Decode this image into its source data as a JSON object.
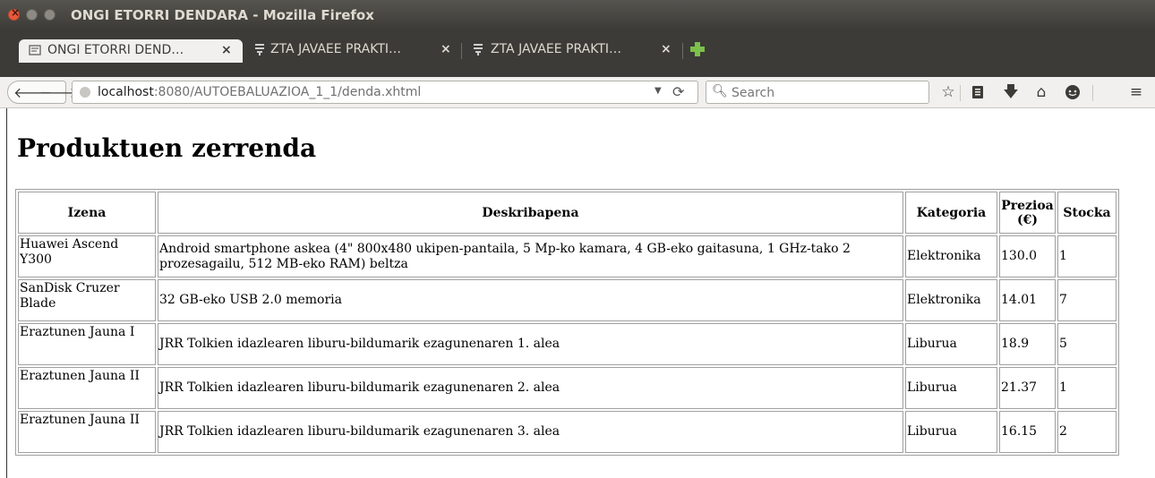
{
  "window": {
    "title": "ONGI ETORRI DENDARA - Mozilla Firefox"
  },
  "tabs": [
    {
      "label": "ONGI ETORRI DEND…",
      "active": true
    },
    {
      "label": "ZTA JAVAEE PRAKTI…",
      "active": false
    },
    {
      "label": "ZTA JAVAEE PRAKTI…",
      "active": false
    }
  ],
  "navbar": {
    "url_host": "localhost",
    "url_rest": ":8080/AUTOEBALUAZIOA_1_1/denda.xhtml",
    "search_placeholder": "Search",
    "icons": [
      "back-icon",
      "forward-icon",
      "reload-icon",
      "bookmark-star-icon",
      "reading-list-icon",
      "download-icon",
      "home-icon",
      "hello-icon",
      "menu-icon"
    ]
  },
  "page": {
    "heading": "Produktuen zerrenda",
    "columns": [
      "Izena",
      "Deskribapena",
      "Kategoria",
      "Prezioa (€)",
      "Stocka"
    ],
    "rows": [
      {
        "izena": "Huawei Ascend Y300",
        "deskribapena": "Android smartphone askea (4\" 800x480 ukipen-pantaila, 5 Mp-ko kamara, 4 GB-eko gaitasuna, 1 GHz-tako 2 prozesagailu, 512 MB-eko RAM) beltza",
        "kategoria": "Elektronika",
        "prezioa": "130.0",
        "stocka": "1"
      },
      {
        "izena": "SanDisk Cruzer Blade",
        "deskribapena": "32 GB-eko USB 2.0 memoria",
        "kategoria": "Elektronika",
        "prezioa": "14.01",
        "stocka": "7"
      },
      {
        "izena": "Eraztunen Jauna I",
        "deskribapena": "JRR Tolkien idazlearen liburu-bildumarik ezagunenaren 1. alea",
        "kategoria": "Liburua",
        "prezioa": "18.9",
        "stocka": "5"
      },
      {
        "izena": "Eraztunen Jauna II",
        "deskribapena": "JRR Tolkien idazlearen liburu-bildumarik ezagunenaren 2. alea",
        "kategoria": "Liburua",
        "prezioa": "21.37",
        "stocka": "1"
      },
      {
        "izena": "Eraztunen Jauna II",
        "deskribapena": "JRR Tolkien idazlearen liburu-bildumarik ezagunenaren 3. alea",
        "kategoria": "Liburua",
        "prezioa": "16.15",
        "stocka": "2"
      }
    ]
  },
  "colors": {
    "titlebar": "#3c3b37",
    "close": "#e8593c",
    "newtab": "#7bc14a"
  }
}
